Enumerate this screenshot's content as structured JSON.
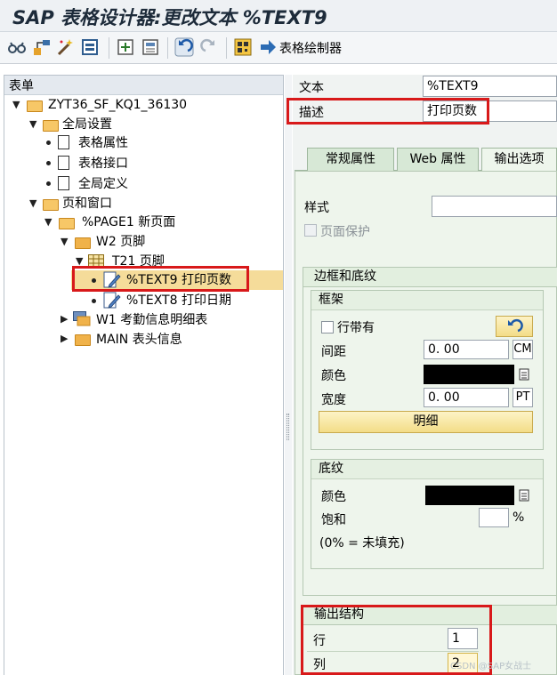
{
  "window": {
    "title": "SAP 表格设计器:更改文本 %TEXT9"
  },
  "toolbar": {
    "icons": [
      "glasses-icon",
      "hierarchy-icon",
      "magic-wand-icon",
      "form-print-icon",
      "insert-node-icon",
      "window-icon",
      "undo-icon",
      "redo-icon",
      "qr-icon",
      "arrow-right-icon"
    ],
    "form_painter_label": "表格绘制器"
  },
  "tree": {
    "header": "表单",
    "nodes": [
      {
        "label": "ZYT36_SF_KQ1_36130"
      },
      {
        "label": "全局设置"
      },
      {
        "label": "表格属性"
      },
      {
        "label": "表格接口"
      },
      {
        "label": "全局定义"
      },
      {
        "label": "页和窗口"
      },
      {
        "label": "%PAGE1 新页面"
      },
      {
        "label": "W2 页脚"
      },
      {
        "label": "T21 页脚"
      },
      {
        "label": "%TEXT9 打印页数"
      },
      {
        "label": "%TEXT8 打印日期"
      },
      {
        "label": "W1 考勤信息明细表"
      },
      {
        "label": "MAIN 表头信息"
      }
    ]
  },
  "detail": {
    "text_label": "文本",
    "text_value": "%TEXT9",
    "desc_label": "描述",
    "desc_value": "打印页数",
    "tabs": [
      "常规属性",
      "Web 属性",
      "输出选项"
    ],
    "style_label": "样式",
    "style_value": "",
    "page_protect_label": "页面保护",
    "border_section": {
      "title": "边框和底纹",
      "frame_title": "框架",
      "with_line_label": "行带有",
      "spacing_label": "间距",
      "spacing_value": "0. 00",
      "spacing_unit": "CM",
      "color_label": "颜色",
      "width_label": "宽度",
      "width_value": "0. 00",
      "width_unit": "PT",
      "detail_button": "明细",
      "shading_title": "底纹",
      "shading_color_label": "颜色",
      "saturation_label": "饱和",
      "saturation_value": "",
      "saturation_unit": "%",
      "note": "(0% = 未填充)"
    },
    "output_structure": {
      "title": "输出结构",
      "row_label": "行",
      "row_value": "1",
      "col_label": "列",
      "col_value": "2"
    }
  },
  "watermark": "CSDN @SAP女战士",
  "colors": {
    "highlight": "#d8191a",
    "selection": "#f5dc9a",
    "folder": "#f0b24a"
  }
}
